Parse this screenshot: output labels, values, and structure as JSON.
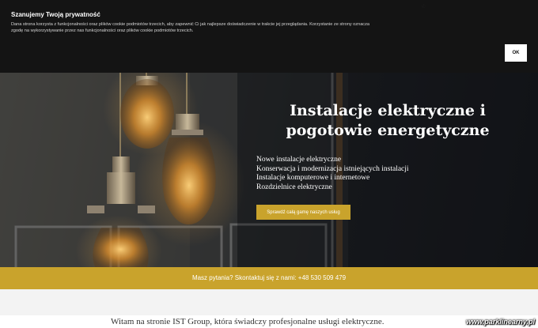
{
  "cookie": {
    "title": "Szanujemy Twoją prywatność",
    "text": "Dana strona korzysta z funkcjonalności oraz plików cookie podmiotów trzecich, aby zapewnić Ci jak najlepsze doświadczenie w trakcie jej przeglądania. Korzystanie ze strony oznacza zgodę na wykorzystywanie przez nas funkcjonalności oraz plików cookie podmiotów trzecich.",
    "ok_label": "OK"
  },
  "hero": {
    "title": "Instalacje elektryczne i pogotowie energetyczne",
    "services": [
      "Nowe instalacje elektryczne",
      "Konserwacja i modernizacja istniejących instalacji",
      "Instalacje komputerowe i internetowe",
      "Rozdzielnice elektryczne"
    ],
    "cta_label": "Sprawdź całą gamę naszych usług"
  },
  "contact": {
    "text": "Masz pytania? Skontaktuj się z nami: +48 530 509 479"
  },
  "welcome": {
    "text": "Witam na stronie IST Group, która świadczy profesjonalne usługi elektryczne."
  },
  "watermark": {
    "text": "www.parklinearny.pl"
  },
  "colors": {
    "accent": "#c9a32c",
    "cookie_bg": "#0e0e0e",
    "hero_text": "#ffffff"
  },
  "icons": {
    "bulbs": "edison-bulb-icon",
    "phone": "phone-icon"
  }
}
